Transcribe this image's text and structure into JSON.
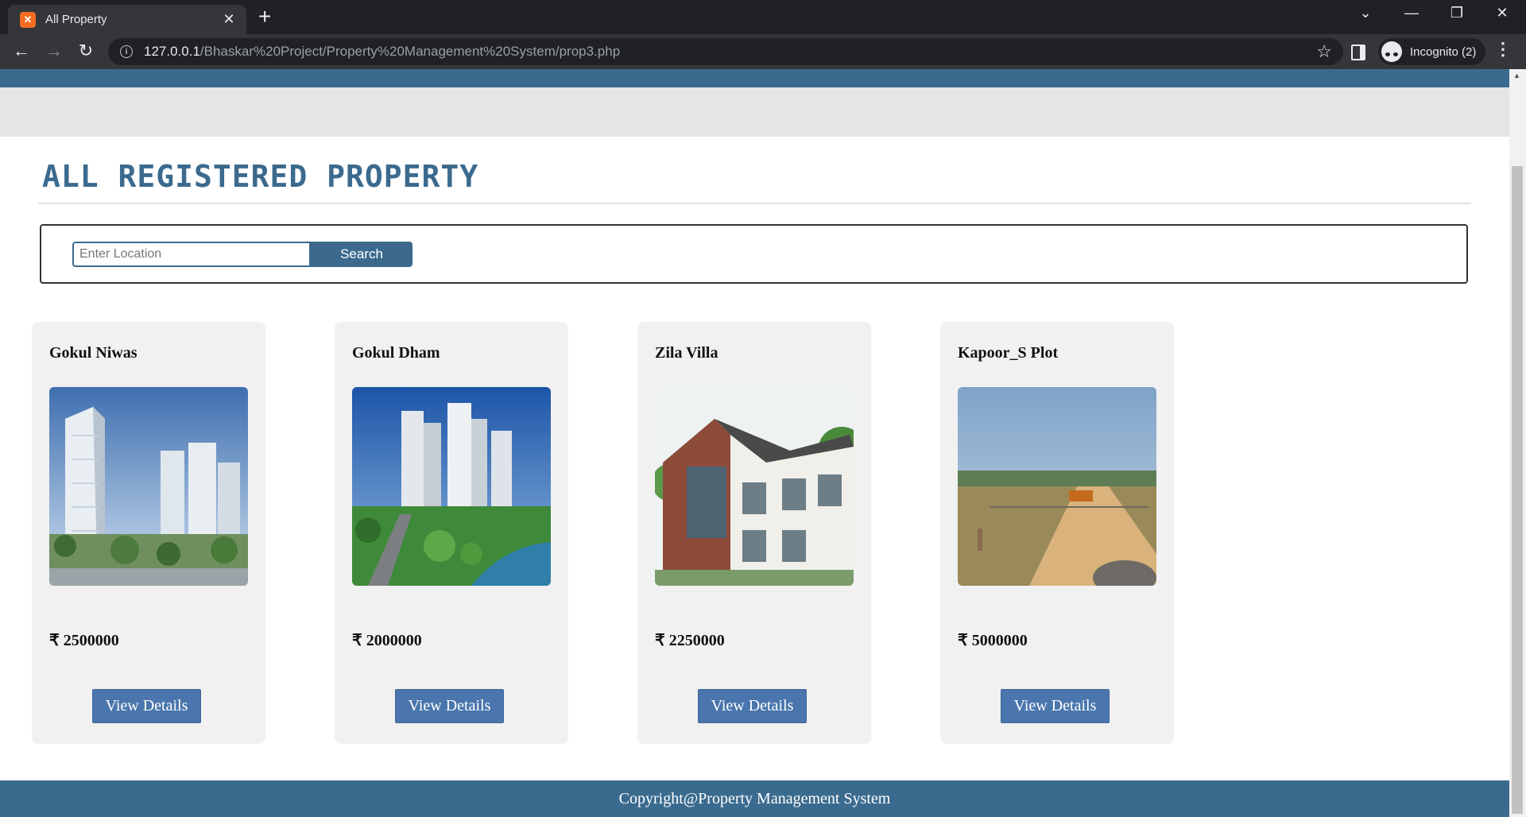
{
  "browser": {
    "tab_title": "All Property",
    "url_host": "127.0.0.1",
    "url_path": "/Bhaskar%20Project/Property%20Management%20System/prop3.php",
    "incognito_label": "Incognito (2)"
  },
  "page": {
    "heading": "ALL REGISTERED PROPERTY",
    "search": {
      "placeholder": "Enter Location",
      "value": "",
      "button_label": "Search"
    },
    "properties": [
      {
        "name": "Gokul Niwas",
        "price": "₹ 2500000",
        "button_label": "View Details",
        "image": "high-rise-towers-photo"
      },
      {
        "name": "Gokul Dham",
        "price": "₹ 2000000",
        "button_label": "View Details",
        "image": "high-rise-aerial-riverside-photo"
      },
      {
        "name": "Zila Villa",
        "price": "₹ 2250000",
        "button_label": "View Details",
        "image": "modern-villa-photo"
      },
      {
        "name": "Kapoor_S Plot",
        "price": "₹ 5000000",
        "button_label": "View Details",
        "image": "open-land-plot-photo"
      }
    ],
    "footer_text": "Copyright@Property Management System"
  },
  "colors": {
    "brand": "#3a6b8f",
    "card_bg": "#f1f1f1",
    "button": "#4a76ad"
  }
}
